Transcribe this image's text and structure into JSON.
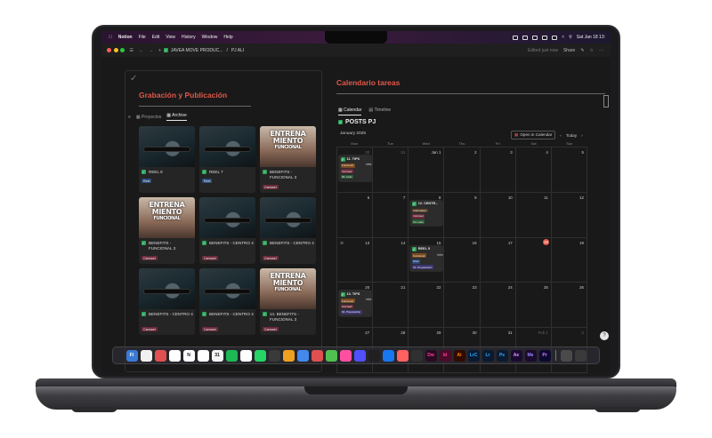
{
  "menubar": {
    "app": "Notion",
    "items": [
      "File",
      "Edit",
      "View",
      "History",
      "Window",
      "Help"
    ],
    "datetime": "Sat Jan 18  13:"
  },
  "topbar": {
    "breadcrumb1": "JAVEA MOVE PRODUC...",
    "breadcrumb_sep": "/",
    "breadcrumb2": "PJ ALI",
    "edited": "Edited just now",
    "share": "Share"
  },
  "left": {
    "title": "Grabación y Publicación",
    "tabs": [
      "Proyectos",
      "Archive"
    ],
    "active_tab": "Archive",
    "cards": [
      {
        "name": "REEL 8",
        "tag": "Reel",
        "thumb": "gym"
      },
      {
        "name": "REEL 7",
        "tag": "Reel",
        "thumb": "gym"
      },
      {
        "name": "BENEFITS - FUNCIONAL 3",
        "tag": "Carrusel",
        "thumb": "poster"
      },
      {
        "name": "BENEFITS - FUNCIONAL 3",
        "tag": "Carrusel",
        "thumb": "poster"
      },
      {
        "name": "BENEFITS - CENTRO 4",
        "tag": "Carrusel",
        "thumb": "gym"
      },
      {
        "name": "BENEFITS - CENTRO 4",
        "tag": "Carrusel",
        "thumb": "gym"
      },
      {
        "name": "BENEFITS - CENTRO 4",
        "tag": "Carrusel",
        "thumb": "gym"
      },
      {
        "name": "BENEFITS - CENTRO 4",
        "tag": "Carrusel",
        "thumb": "gym"
      },
      {
        "name": "14. BENEFITS - FUNCIONAL 3",
        "tag": "Carrusel",
        "thumb": "poster"
      }
    ],
    "poster_text": [
      "ENTRENA",
      "MIENTO",
      "FUNCIONAL"
    ]
  },
  "right": {
    "title": "Calendario tareas",
    "tabs": [
      "Calendar",
      "Timeline"
    ],
    "active_tab": "Calendar",
    "db_title": "POSTS PJ",
    "month": "January 2025",
    "open_in_calendar": "Open in Calendar",
    "today": "Today",
    "weekdays": [
      "Mon",
      "Tue",
      "Wed",
      "Thu",
      "Fri",
      "Sat",
      "Sun"
    ],
    "days": [
      "30",
      "31",
      "Jan 1",
      "2",
      "3",
      "4",
      "5",
      "6",
      "7",
      "8",
      "9",
      "10",
      "11",
      "12",
      "13",
      "14",
      "15",
      "16",
      "17",
      "18",
      "19",
      "20",
      "21",
      "22",
      "23",
      "24",
      "25",
      "26",
      "27",
      "28",
      "29",
      "30",
      "31",
      "Feb 1",
      "2"
    ],
    "events": [
      {
        "title": "11. TIPS",
        "badges": [
          "Funcional",
          "Carrusel",
          "04. Listo"
        ],
        "extra": "infor"
      },
      {
        "title": "12. CENTR...",
        "badges": [
          "Informativo",
          "Carrusel",
          "04. Listo"
        ],
        "extra": ""
      },
      {
        "title": "REEL 5",
        "badges": [
          "Funcional",
          "Reel",
          "01. Preparación"
        ],
        "extra": "infor"
      },
      {
        "title": "13. TIPS",
        "badges": [
          "Funcional",
          "Carrusel",
          "04. Preparación"
        ],
        "extra": "infor"
      }
    ]
  },
  "dock": {
    "apps": [
      "Fi",
      "",
      "",
      "",
      "N",
      "",
      "31",
      "",
      "",
      "",
      "",
      "",
      "",
      "",
      "",
      "",
      "",
      "",
      "",
      "",
      "",
      "Dw",
      "Id",
      "Ai",
      "LrC",
      "Lr",
      "Ps",
      "Ae",
      "Me",
      "Pr",
      "",
      ""
    ]
  },
  "help": "?"
}
